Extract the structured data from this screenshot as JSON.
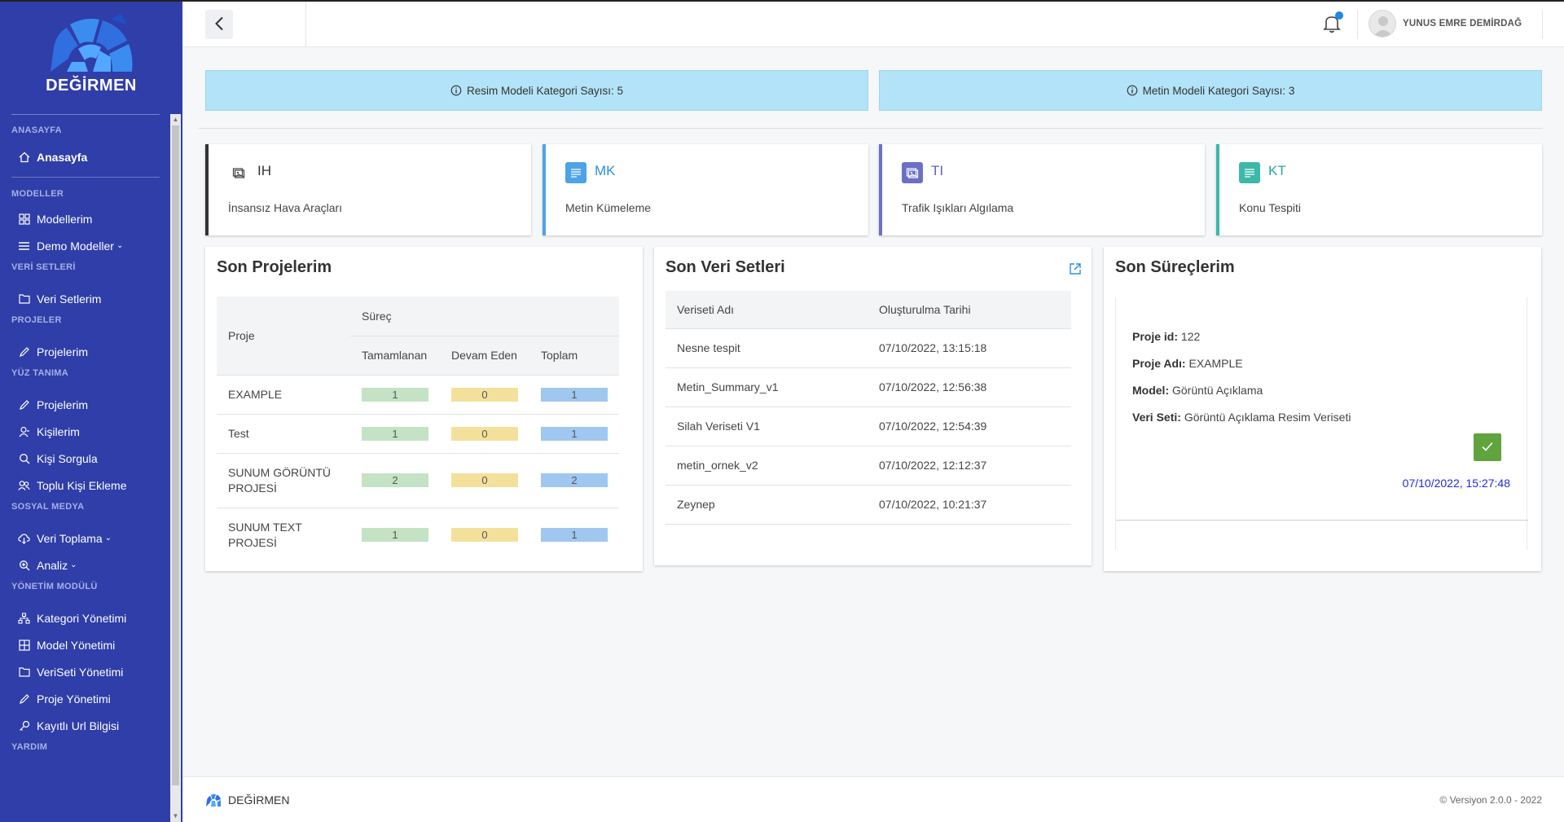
{
  "brand": {
    "name": "DEĞİRMEN"
  },
  "sidebar": {
    "sections": [
      {
        "title": "ANASAYFA",
        "items": [
          {
            "label": "Anasayfa",
            "icon": "home-icon"
          }
        ]
      },
      {
        "title": "MODELLER",
        "items": [
          {
            "label": "Modellerim",
            "icon": "grid-icon"
          },
          {
            "label": "Demo Modeller",
            "icon": "menu-icon",
            "caret": true
          }
        ]
      },
      {
        "title": "VERİ SETLERİ",
        "items": [
          {
            "label": "Veri Setlerim",
            "icon": "folder-icon"
          }
        ]
      },
      {
        "title": "PROJELER",
        "items": [
          {
            "label": "Projelerim",
            "icon": "pencil-icon"
          }
        ]
      },
      {
        "title": "YÜZ TANIMA",
        "items": [
          {
            "label": "Projelerim",
            "icon": "pencil-icon"
          },
          {
            "label": "Kişilerim",
            "icon": "user-icon"
          },
          {
            "label": "Kişi Sorgula",
            "icon": "search-icon"
          },
          {
            "label": "Toplu Kişi Ekleme",
            "icon": "users-icon"
          }
        ]
      },
      {
        "title": "SOSYAL MEDYA",
        "items": [
          {
            "label": "Veri Toplama",
            "icon": "cloud-download-icon",
            "caret": true
          },
          {
            "label": "Analiz",
            "icon": "zoom-in-icon",
            "caret": true
          }
        ]
      },
      {
        "title": "YÖNETİM MODÜLÜ",
        "items": [
          {
            "label": "Kategori Yönetimi",
            "icon": "sitemap-icon"
          },
          {
            "label": "Model Yönetimi",
            "icon": "table-icon"
          },
          {
            "label": "VeriSeti Yönetimi",
            "icon": "folder-icon"
          },
          {
            "label": "Proje Yönetimi",
            "icon": "pencil-icon"
          },
          {
            "label": "Kayıtlı Url Bilgisi",
            "icon": "key-icon"
          }
        ]
      },
      {
        "title": "YARDIM",
        "items": []
      }
    ]
  },
  "header": {
    "user_name": "YUNUS EMRE DEMİRDAĞ"
  },
  "info_bars": [
    {
      "text": "Resim Modeli Kategori Sayısı: 5"
    },
    {
      "text": "Metin Modeli Kategori Sayısı: 3"
    }
  ],
  "stat_cards": [
    {
      "code": "IH",
      "title": "İnsansız Hava Araçları",
      "accent": "#333333",
      "code_color": "#333333",
      "icon": "image-icon",
      "icon_bg": "#ffffff",
      "icon_color": "#444444"
    },
    {
      "code": "MK",
      "title": "Metin Kümeleme",
      "accent": "#4da3e6",
      "code_color": "#2a8fe0",
      "icon": "text-lines-icon",
      "icon_bg": "#4da3e6",
      "icon_color": "#ffffff"
    },
    {
      "code": "TI",
      "title": "Trafik Işıkları Algılama",
      "accent": "#6a70c8",
      "code_color": "#5c63c2",
      "icon": "image-icon",
      "icon_bg": "#6a70c8",
      "icon_color": "#ffffff"
    },
    {
      "code": "KT",
      "title": "Konu Tespiti",
      "accent": "#3cb8a8",
      "code_color": "#2aa797",
      "icon": "text-lines-icon",
      "icon_bg": "#3cb8a8",
      "icon_color": "#ffffff"
    }
  ],
  "projects": {
    "title": "Son Projelerim",
    "headers": {
      "project": "Proje",
      "process": "Süreç",
      "completed": "Tamamlanan",
      "ongoing": "Devam Eden",
      "total": "Toplam"
    },
    "rows": [
      {
        "name": "EXAMPLE",
        "completed": "1",
        "ongoing": "0",
        "total": "1"
      },
      {
        "name": "Test",
        "completed": "1",
        "ongoing": "0",
        "total": "1"
      },
      {
        "name": "SUNUM GÖRÜNTÜ PROJESİ",
        "completed": "2",
        "ongoing": "0",
        "total": "2"
      },
      {
        "name": "SUNUM TEXT PROJESİ",
        "completed": "1",
        "ongoing": "0",
        "total": "1"
      }
    ]
  },
  "datasets": {
    "title": "Son Veri Setleri",
    "headers": {
      "name": "Veriseti Adı",
      "created": "Oluşturulma Tarihi"
    },
    "rows": [
      {
        "name": "Nesne tespit",
        "created": "07/10/2022, 13:15:18"
      },
      {
        "name": "Metin_Summary_v1",
        "created": "07/10/2022, 12:56:38"
      },
      {
        "name": "Silah Veriseti V1",
        "created": "07/10/2022, 12:54:39"
      },
      {
        "name": "metin_ornek_v2",
        "created": "07/10/2022, 12:12:37"
      },
      {
        "name": "Zeynep",
        "created": "07/10/2022, 10:21:37"
      }
    ]
  },
  "processes": {
    "title": "Son Süreçlerim",
    "lines": [
      {
        "label": "Proje id:",
        "value": "122"
      },
      {
        "label": "Proje Adı:",
        "value": "EXAMPLE"
      },
      {
        "label": "Model:",
        "value": "Görüntü Açıklama"
      },
      {
        "label": "Veri Seti:",
        "value": "Görüntü Açıklama Resim Veriseti"
      }
    ],
    "date": "07/10/2022, 15:27:48"
  },
  "footer": {
    "brand": "DEĞİRMEN",
    "version": "© Versiyon 2.0.0 - 2022"
  }
}
